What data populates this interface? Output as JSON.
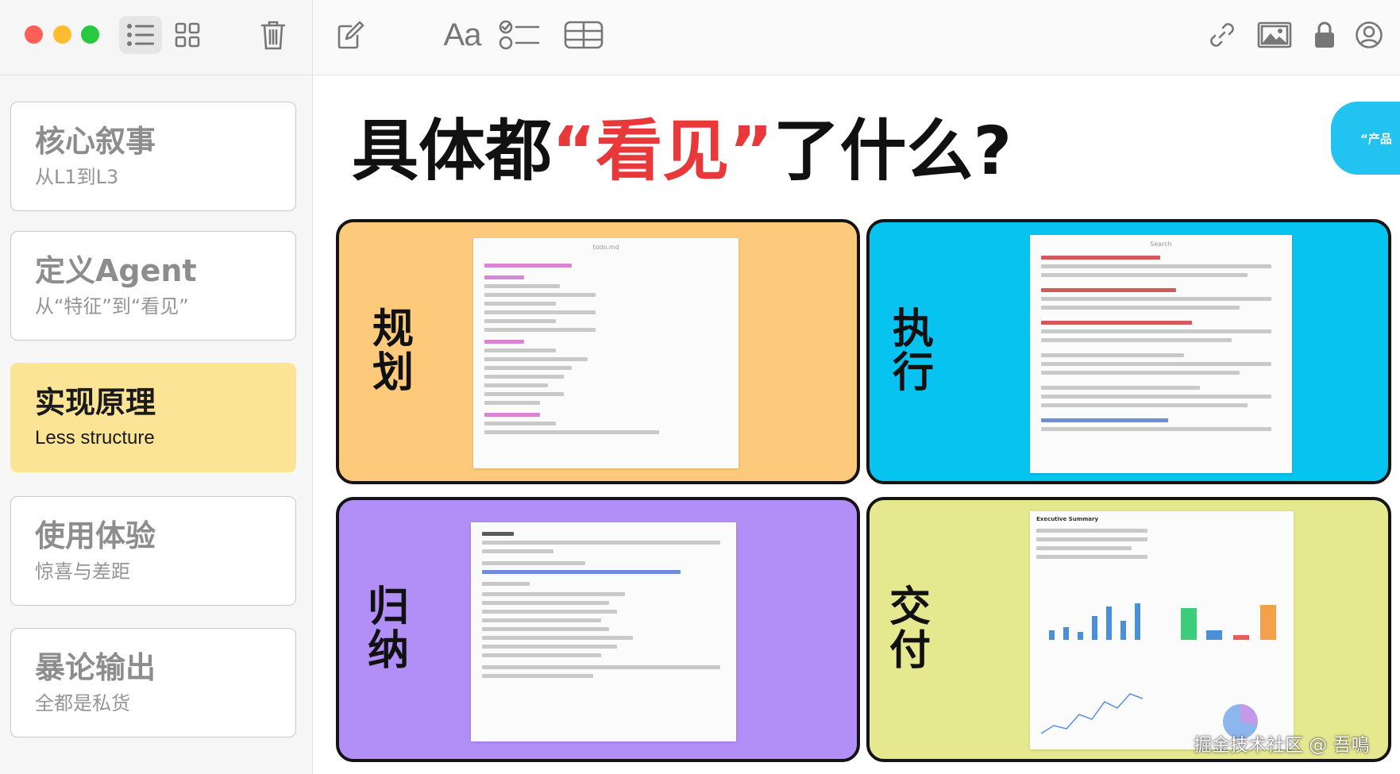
{
  "sidebar": {
    "cards": [
      {
        "title": "核心叙事",
        "subtitle": "从L1到L3"
      },
      {
        "title": "定义Agent",
        "subtitle": "从“特征”到“看见”"
      },
      {
        "title": "实现原理",
        "subtitle": "Less structure"
      },
      {
        "title": "使用体验",
        "subtitle": "惊喜与差距"
      },
      {
        "title": "暴论输出",
        "subtitle": "全都是私货"
      }
    ],
    "selected_index": 2
  },
  "toolbar": {
    "font_label": "Aa",
    "icons": [
      "list-view-icon",
      "grid-view-icon",
      "trash-icon",
      "compose-icon",
      "font-format-icon",
      "checklist-icon",
      "table-icon",
      "link-icon",
      "image-icon",
      "lock-icon",
      "account-icon"
    ]
  },
  "slide": {
    "heading_pre": "具体都",
    "heading_accent": "“看见”",
    "heading_post": "了什么?",
    "peek_tab": "“产品",
    "panels": [
      {
        "label": "规划",
        "color": "#fdc97b",
        "screenshot_title": "todo.md"
      },
      {
        "label": "执行",
        "color": "#06c3f0",
        "screenshot_title": "Search"
      },
      {
        "label": "归纳",
        "color": "#b18ff7",
        "screenshot_title": ""
      },
      {
        "label": "交付",
        "color": "#e5e88f",
        "screenshot_title": "Executive Summary"
      }
    ]
  },
  "watermark": "掘金技术社区 @ 吾鳴",
  "colors": {
    "accent_red": "#e9383a",
    "selected_card": "#fce497",
    "peek_tab": "#22c3f0"
  }
}
